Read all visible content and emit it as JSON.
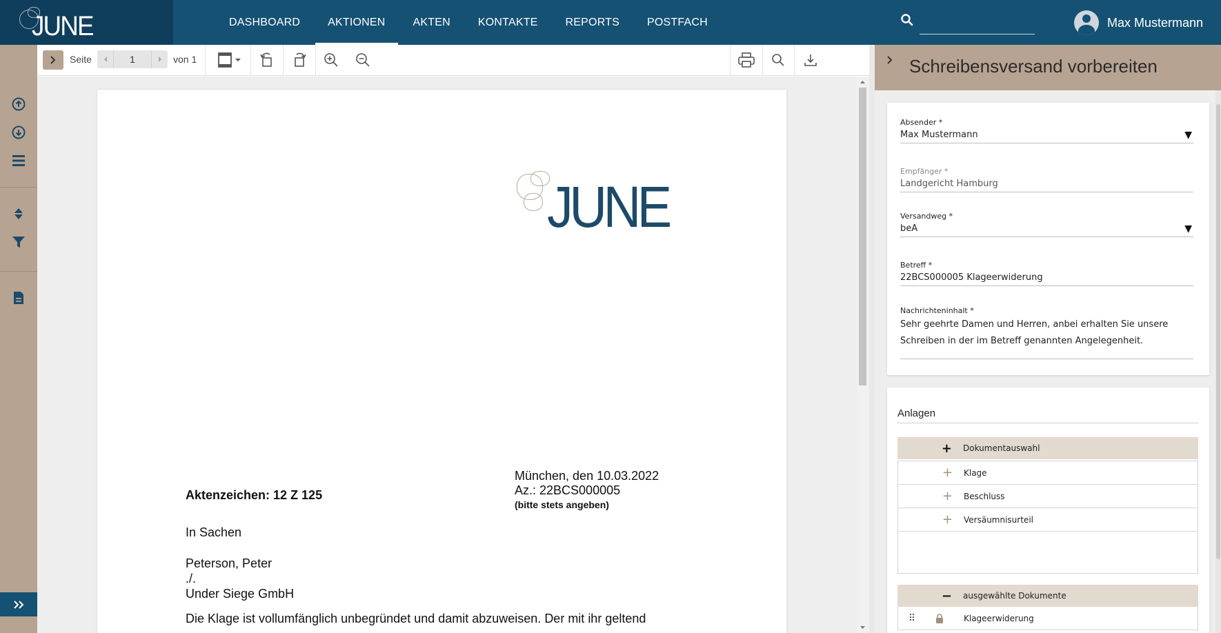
{
  "app": {
    "brand": "JUNE",
    "colors": {
      "nav_bg": "#155173",
      "brand_bg": "#0f3e5c",
      "rail_bg": "#b7a391",
      "accent_row": "#e2d9cf"
    }
  },
  "nav": {
    "items": [
      {
        "label": "DASHBOARD",
        "active": false
      },
      {
        "label": "AKTIONEN",
        "active": true
      },
      {
        "label": "AKTEN",
        "active": false
      },
      {
        "label": "KONTAKTE",
        "active": false
      },
      {
        "label": "REPORTS",
        "active": false
      },
      {
        "label": "POSTFACH",
        "active": false
      }
    ],
    "search_value": "",
    "user_name": "Max Mustermann"
  },
  "rail": {
    "icons": [
      "upload-icon",
      "download-icon",
      "list-icon",
      "sort-icon",
      "filter-icon",
      "document-icon"
    ],
    "expand_icon": "double-chevron-right-icon"
  },
  "viewer": {
    "page_label": "Seite",
    "page_current": "1",
    "page_total_label": "von 1",
    "icons": [
      "fit-page-icon",
      "rotate-left-icon",
      "rotate-right-icon",
      "zoom-in-icon",
      "zoom-out-icon",
      "print-icon",
      "search-icon",
      "download-icon"
    ]
  },
  "document": {
    "logo_text": "JUNE",
    "date_line": "München, den 10.03.2022",
    "az_line": "Az.: 22BCS000005",
    "az_note": "(bitte stets angeben)",
    "aktenzeichen": "Aktenzeichen: 12 Z 125",
    "in_sachen": "In Sachen",
    "party1": "Peterson, Peter",
    "versus": "./.",
    "party2": "Under Siege GmbH",
    "body_start": "Die Klage ist vollumfänglich unbegründet und damit abzuweisen. Der mit ihr geltend"
  },
  "panel": {
    "title": "Schreibensversand vorbereiten",
    "absender_label": "Absender *",
    "absender_value": "Max Mustermann",
    "empfaenger_label": "Empfänger *",
    "empfaenger_value": "Landgericht Hamburg",
    "versandweg_label": "Versandweg *",
    "versandweg_value": "beA",
    "betreff_label": "Betreff *",
    "betreff_value": "22BCS000005 Klageerwiderung",
    "nachricht_label": "Nachrichteninhalt *",
    "nachricht_value": "Sehr geehrte Damen und Herren, anbei erhalten Sie unsere Schreiben in der im Betreff genannten Angelegenheit.",
    "anlagen_title": "Anlagen",
    "dokumentauswahl_label": "Dokumentauswahl",
    "documents": [
      {
        "name": "Klage"
      },
      {
        "name": "Beschluss"
      },
      {
        "name": "Versäumnisurteil"
      }
    ],
    "selected_label": "ausgewählte Dokumente",
    "selected_docs": [
      {
        "name": "Klageerwiderung"
      }
    ]
  }
}
